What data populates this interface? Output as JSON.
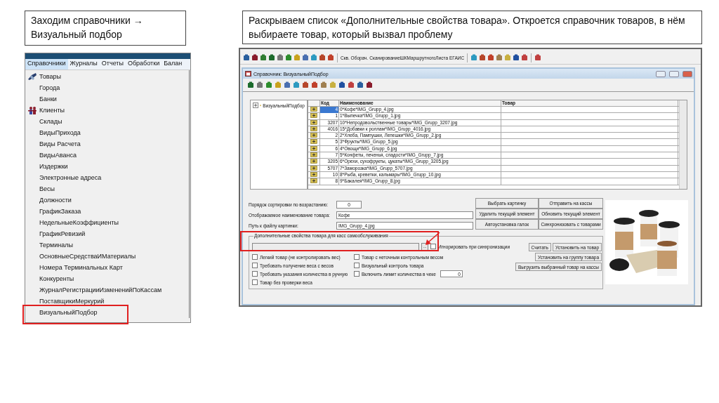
{
  "captions": [
    {
      "text": "Заходим справочники → Визуальный подбор"
    },
    {
      "text": "Раскрываем список «Дополнительные свойства товара». Откроется справочник товаров, в нём выбираете товар, который вызвал проблему"
    }
  ],
  "menu_screenshot": {
    "menu_bar": [
      {
        "label": "Справочники",
        "selected": true
      },
      {
        "label": "Журналы",
        "selected": false
      },
      {
        "label": "Отчеты",
        "selected": false
      },
      {
        "label": "Обработки",
        "selected": false
      },
      {
        "label": "Балан",
        "selected": false
      }
    ],
    "items": [
      {
        "label": "Товары",
        "kind": "goods"
      },
      {
        "label": "Города",
        "kind": "plain"
      },
      {
        "label": "Банки",
        "kind": "plain"
      },
      {
        "label": "Клиенты",
        "kind": "clients"
      },
      {
        "label": "Склады",
        "kind": "plain"
      },
      {
        "label": "ВидыПрихода",
        "kind": "plain"
      },
      {
        "label": "Виды Расчета",
        "kind": "plain"
      },
      {
        "label": "ВидыАванса",
        "kind": "plain"
      },
      {
        "label": "Издержки",
        "kind": "plain"
      },
      {
        "label": "Электронные адреса",
        "kind": "plain"
      },
      {
        "label": "Весы",
        "kind": "plain"
      },
      {
        "label": "Должности",
        "kind": "plain"
      },
      {
        "label": "ГрафикЗаказа",
        "kind": "plain"
      },
      {
        "label": "НедельныеКоэффициенты",
        "kind": "plain"
      },
      {
        "label": "ГрафикРевизий",
        "kind": "plain"
      },
      {
        "label": "Терминалы",
        "kind": "plain"
      },
      {
        "label": "ОсновныеСредстваИМатериалы",
        "kind": "plain"
      },
      {
        "label": "Номера  Терминальных Карт",
        "kind": "plain"
      },
      {
        "label": "Конкуренты",
        "kind": "plain"
      },
      {
        "label": "ЖурналРегистрацииИзмененийПоКассам",
        "kind": "plain"
      },
      {
        "label": "ПоставщикиМеркурий",
        "kind": "plain"
      },
      {
        "label": "ВизуальныйПодбор",
        "kind": "plain"
      }
    ]
  },
  "app_window": {
    "toolbar_labels": [
      "Скв. Оборач.",
      "СканированиеШКМаршрутногоЛиста",
      "ЕГАИС"
    ],
    "child_window": {
      "title": "Справочник: ВизуальныйПодбор",
      "tree": [
        {
          "label": "ВизуальныйПодбор",
          "expanded": false
        }
      ],
      "table": {
        "columns": [
          "Код",
          "Наименование",
          "Товар"
        ],
        "rows": [
          {
            "code": "4",
            "name": "0*Кофе*IMG_Grupp_4.jpg",
            "selected": true
          },
          {
            "code": "1",
            "name": "1*Выпечка*IMG_Grupp_1.jpg",
            "selected": false
          },
          {
            "code": "3207",
            "name": "10*Непродовольственные товары*IMG_Grupp_3207.jpg",
            "selected": false
          },
          {
            "code": "4016",
            "name": "15*Добавки к роллам*IMG_Grupp_4016.jpg",
            "selected": false
          },
          {
            "code": "2",
            "name": "2*Хлеба, Пампушки, Лепешки*IMG_Grupp_2.jpg",
            "selected": false
          },
          {
            "code": "5",
            "name": "3*Фрукты*IMG_Grupp_5.jpg",
            "selected": false
          },
          {
            "code": "6",
            "name": "4*Овощи*IMG_Grupp_6.jpg",
            "selected": false
          },
          {
            "code": "7",
            "name": "5*Конфеты, печенья, сладости*IMG_Grupp_7.jpg",
            "selected": false
          },
          {
            "code": "3205",
            "name": "6*Орехи, сухофрукты, цукаты*IMG_Grupp_3205.jpg",
            "selected": false
          },
          {
            "code": "5707",
            "name": "7*Заморозка*IMG_Grupp_5707.jpg",
            "selected": false
          },
          {
            "code": "10",
            "name": "8*Рыба, креветки, кальмары*IMG_Grupp_10.jpg",
            "selected": false
          },
          {
            "code": "8",
            "name": "9*Бакалея*IMG_Grupp_8.jpg",
            "selected": false
          }
        ]
      },
      "fields": [
        {
          "label": "Порядок сортировки по возрастанию:",
          "value": "0",
          "kind": "number"
        },
        {
          "label": "Отображаемое наименование товара:",
          "value": "Кофе",
          "kind": "text"
        },
        {
          "label": "Путь к файлу картинки:",
          "value": "IMG_Grupp_4.jpg",
          "kind": "text"
        }
      ],
      "buttons": [
        "Выбрать картинку",
        "Отправить на кассы",
        "Удалить текущий элемент",
        "Обновить текущий элемент",
        "Автоустановка галок",
        "Синхронизовать с товарами"
      ],
      "self_service_group": {
        "title": "Дополнительные свойства товара для касс самообслуживания",
        "chooser_button": "...",
        "ignore_checkbox": {
          "label": "Игнорировать при синхронизации",
          "checked": false
        },
        "checkboxes": [
          {
            "label": "Легкий товар (не контролировать вес)",
            "checked": false,
            "kind": "plain"
          },
          {
            "label": "Товар с неточным контрольным весом",
            "checked": false,
            "kind": "plain"
          },
          {
            "label": "Требовать получение веса с весов",
            "checked": false,
            "kind": "plain"
          },
          {
            "label": "Визуальный контроль товара",
            "checked": false,
            "kind": "plain"
          },
          {
            "label": "Требовать указания количества в ручную",
            "checked": false,
            "kind": "plain"
          },
          {
            "label": "Включить лимит количества в чеке",
            "checked": false,
            "kind": "limit",
            "field_value": "0"
          },
          {
            "label": "Товар без проверки веса",
            "checked": false,
            "kind": "plain"
          }
        ],
        "buttons": [
          "Считать",
          "Установить на товар",
          "Установить на группу товара",
          "Выгрузить выбранный товар на кассы"
        ]
      },
      "image": {
        "kind": "picture"
      }
    }
  }
}
